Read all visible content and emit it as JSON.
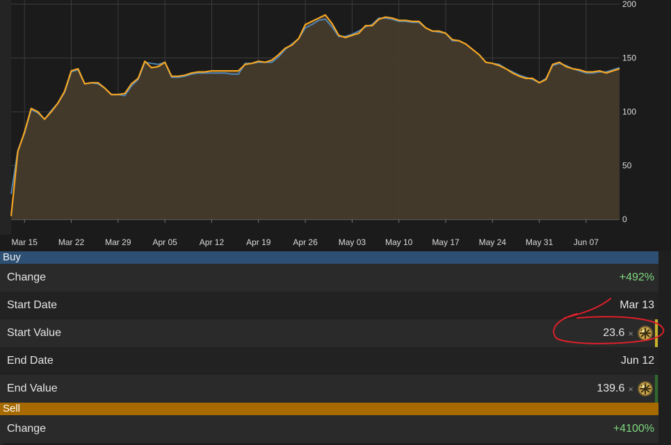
{
  "chart_data": {
    "type": "area",
    "x_ticks": [
      "Mar 15",
      "Mar 22",
      "Mar 29",
      "Apr 05",
      "Apr 12",
      "Apr 19",
      "Apr 26",
      "May 03",
      "May 10",
      "May 17",
      "May 24",
      "May 31",
      "Jun 07"
    ],
    "y_ticks": [
      0,
      50,
      100,
      150,
      200
    ],
    "ylim": [
      0,
      200
    ],
    "grid": true,
    "x_start": "Mar 13",
    "x_end": "Jun 12",
    "series": [
      {
        "color": "#4f86b8",
        "points": [
          [
            "Mar 13",
            23.6
          ],
          [
            "Mar 14",
            64
          ],
          [
            "Mar 15",
            80
          ],
          [
            "Mar 16",
            102
          ],
          [
            "Mar 17",
            99
          ],
          [
            "Mar 18",
            93
          ],
          [
            "Mar 19",
            101
          ],
          [
            "Mar 20",
            108
          ],
          [
            "Mar 21",
            118
          ],
          [
            "Mar 22",
            137
          ],
          [
            "Mar 23",
            139
          ],
          [
            "Mar 24",
            126
          ],
          [
            "Mar 25",
            127
          ],
          [
            "Mar 26",
            126
          ],
          [
            "Mar 27",
            122
          ],
          [
            "Mar 28",
            116
          ],
          [
            "Mar 29",
            116
          ],
          [
            "Mar 30",
            115
          ],
          [
            "Mar 31",
            124
          ],
          [
            "Apr 01",
            130
          ],
          [
            "Apr 02",
            146
          ],
          [
            "Apr 03",
            145
          ],
          [
            "Apr 04",
            144
          ],
          [
            "Apr 05",
            146
          ],
          [
            "Apr 06",
            132
          ],
          [
            "Apr 07",
            132
          ],
          [
            "Apr 08",
            133
          ],
          [
            "Apr 09",
            135
          ],
          [
            "Apr 10",
            136
          ],
          [
            "Apr 11",
            136
          ],
          [
            "Apr 12",
            136
          ],
          [
            "Apr 13",
            136
          ],
          [
            "Apr 14",
            136
          ],
          [
            "Apr 15",
            135
          ],
          [
            "Apr 16",
            135
          ],
          [
            "Apr 17",
            145
          ],
          [
            "Apr 18",
            145
          ],
          [
            "Apr 19",
            146
          ],
          [
            "Apr 20",
            146
          ],
          [
            "Apr 21",
            146
          ],
          [
            "Apr 22",
            151
          ],
          [
            "Apr 23",
            158
          ],
          [
            "Apr 24",
            163
          ],
          [
            "Apr 25",
            168
          ],
          [
            "Apr 26",
            178
          ],
          [
            "Apr 27",
            181
          ],
          [
            "Apr 28",
            185
          ],
          [
            "Apr 29",
            186
          ],
          [
            "Apr 30",
            179
          ],
          [
            "May 01",
            170
          ],
          [
            "May 02",
            170
          ],
          [
            "May 03",
            172
          ],
          [
            "May 04",
            175
          ],
          [
            "May 05",
            179
          ],
          [
            "May 06",
            181
          ],
          [
            "May 07",
            187
          ],
          [
            "May 08",
            187
          ],
          [
            "May 09",
            186
          ],
          [
            "May 10",
            184
          ],
          [
            "May 11",
            184
          ],
          [
            "May 12",
            183
          ],
          [
            "May 13",
            183
          ],
          [
            "May 14",
            178
          ],
          [
            "May 15",
            175
          ],
          [
            "May 16",
            174
          ],
          [
            "May 17",
            173
          ],
          [
            "May 18",
            166
          ],
          [
            "May 19",
            166
          ],
          [
            "May 20",
            163
          ],
          [
            "May 21",
            158
          ],
          [
            "May 22",
            153
          ],
          [
            "May 23",
            146
          ],
          [
            "May 24",
            145
          ],
          [
            "May 25",
            144
          ],
          [
            "May 26",
            140
          ],
          [
            "May 27",
            137
          ],
          [
            "May 28",
            134
          ],
          [
            "May 29",
            132
          ],
          [
            "May 30",
            130
          ],
          [
            "May 31",
            127
          ],
          [
            "Jun 01",
            131
          ],
          [
            "Jun 02",
            143
          ],
          [
            "Jun 03",
            145
          ],
          [
            "Jun 04",
            143
          ],
          [
            "Jun 05",
            140
          ],
          [
            "Jun 06",
            138
          ],
          [
            "Jun 07",
            136
          ],
          [
            "Jun 08",
            136
          ],
          [
            "Jun 09",
            137
          ],
          [
            "Jun 10",
            137
          ],
          [
            "Jun 11",
            139
          ],
          [
            "Jun 12",
            141
          ]
        ]
      },
      {
        "color": "#f5a623",
        "points": [
          [
            "Mar 13",
            3
          ],
          [
            "Mar 14",
            63
          ],
          [
            "Mar 15",
            81
          ],
          [
            "Mar 16",
            103
          ],
          [
            "Mar 17",
            100
          ],
          [
            "Mar 18",
            93
          ],
          [
            "Mar 19",
            100
          ],
          [
            "Mar 20",
            108
          ],
          [
            "Mar 21",
            119
          ],
          [
            "Mar 22",
            138
          ],
          [
            "Mar 23",
            140
          ],
          [
            "Mar 24",
            126
          ],
          [
            "Mar 25",
            127
          ],
          [
            "Mar 26",
            127
          ],
          [
            "Mar 27",
            122
          ],
          [
            "Mar 28",
            116
          ],
          [
            "Mar 29",
            116
          ],
          [
            "Mar 30",
            117
          ],
          [
            "Mar 31",
            126
          ],
          [
            "Apr 01",
            131
          ],
          [
            "Apr 02",
            147
          ],
          [
            "Apr 03",
            141
          ],
          [
            "Apr 04",
            142
          ],
          [
            "Apr 05",
            146
          ],
          [
            "Apr 06",
            133
          ],
          [
            "Apr 07",
            133
          ],
          [
            "Apr 08",
            134
          ],
          [
            "Apr 09",
            136
          ],
          [
            "Apr 10",
            137
          ],
          [
            "Apr 11",
            137
          ],
          [
            "Apr 12",
            138
          ],
          [
            "Apr 13",
            138
          ],
          [
            "Apr 14",
            138
          ],
          [
            "Apr 15",
            138
          ],
          [
            "Apr 16",
            138
          ],
          [
            "Apr 17",
            144
          ],
          [
            "Apr 18",
            145
          ],
          [
            "Apr 19",
            147
          ],
          [
            "Apr 20",
            146
          ],
          [
            "Apr 21",
            148
          ],
          [
            "Apr 22",
            153
          ],
          [
            "Apr 23",
            159
          ],
          [
            "Apr 24",
            162
          ],
          [
            "Apr 25",
            168
          ],
          [
            "Apr 26",
            181
          ],
          [
            "Apr 27",
            184
          ],
          [
            "Apr 28",
            187
          ],
          [
            "Apr 29",
            190
          ],
          [
            "Apr 30",
            182
          ],
          [
            "May 01",
            171
          ],
          [
            "May 02",
            169
          ],
          [
            "May 03",
            171
          ],
          [
            "May 04",
            173
          ],
          [
            "May 05",
            180
          ],
          [
            "May 06",
            180
          ],
          [
            "May 07",
            186
          ],
          [
            "May 08",
            188
          ],
          [
            "May 09",
            187
          ],
          [
            "May 10",
            185
          ],
          [
            "May 11",
            185
          ],
          [
            "May 12",
            184
          ],
          [
            "May 13",
            184
          ],
          [
            "May 14",
            178
          ],
          [
            "May 15",
            175
          ],
          [
            "May 16",
            175
          ],
          [
            "May 17",
            173
          ],
          [
            "May 18",
            167
          ],
          [
            "May 19",
            166
          ],
          [
            "May 20",
            163
          ],
          [
            "May 21",
            158
          ],
          [
            "May 22",
            153
          ],
          [
            "May 23",
            146
          ],
          [
            "May 24",
            145
          ],
          [
            "May 25",
            143
          ],
          [
            "May 26",
            140
          ],
          [
            "May 27",
            136
          ],
          [
            "May 28",
            133
          ],
          [
            "May 29",
            131
          ],
          [
            "May 30",
            131
          ],
          [
            "May 31",
            127
          ],
          [
            "Jun 01",
            130
          ],
          [
            "Jun 02",
            144
          ],
          [
            "Jun 03",
            146
          ],
          [
            "Jun 04",
            142
          ],
          [
            "Jun 05",
            140
          ],
          [
            "Jun 06",
            139
          ],
          [
            "Jun 07",
            137
          ],
          [
            "Jun 08",
            137
          ],
          [
            "Jun 09",
            138
          ],
          [
            "Jun 10",
            136
          ],
          [
            "Jun 11",
            138
          ],
          [
            "Jun 12",
            140
          ]
        ]
      }
    ]
  },
  "buy": {
    "header": "Buy",
    "change_label": "Change",
    "change_value": "+492%",
    "start_date_label": "Start Date",
    "start_date_value": "Mar 13",
    "start_value_label": "Start Value",
    "start_value_value": "23.6",
    "end_date_label": "End Date",
    "end_date_value": "Jun 12",
    "end_value_label": "End Value",
    "end_value_value": "139.6",
    "multiplier": "×",
    "currency_icon": "exalted-orb-icon"
  },
  "sell": {
    "header": "Sell",
    "change_label": "Change",
    "change_value": "+4100%"
  },
  "colors": {
    "buy_header": "#2c4f73",
    "sell_header": "#a66a00",
    "positive": "#7fd77f",
    "area_fill": "#453b2c",
    "annotation": "#e0202a"
  }
}
